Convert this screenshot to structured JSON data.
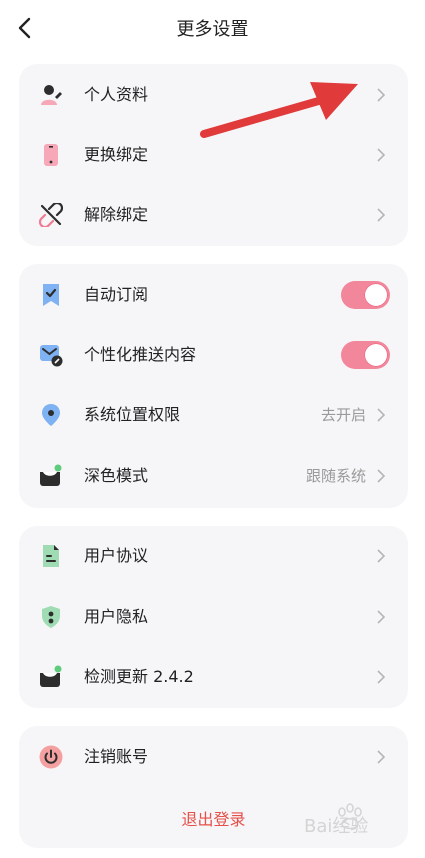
{
  "header": {
    "title": "更多设置"
  },
  "group1": [
    {
      "label": "个人资料",
      "icon": "profile-icon"
    },
    {
      "label": "更换绑定",
      "icon": "phone-icon"
    },
    {
      "label": "解除绑定",
      "icon": "unlink-icon"
    }
  ],
  "group2": [
    {
      "label": "自动订阅",
      "icon": "bookmark-icon",
      "toggle": true
    },
    {
      "label": "个性化推送内容",
      "icon": "push-mail-icon",
      "toggle": true
    },
    {
      "label": "系统位置权限",
      "icon": "location-icon",
      "value": "去开启"
    },
    {
      "label": "深色模式",
      "icon": "dark-mode-icon",
      "value": "跟随系统"
    }
  ],
  "group3": [
    {
      "label": "用户协议",
      "icon": "agreement-icon"
    },
    {
      "label": "用户隐私",
      "icon": "privacy-icon"
    },
    {
      "label": "检测更新 2.4.2",
      "icon": "update-icon"
    }
  ],
  "group4": [
    {
      "label": "注销账号",
      "icon": "power-icon"
    }
  ],
  "logout_label": "退出登录",
  "watermark_text": "Bai经验",
  "colors": {
    "accent": "#f2869b",
    "danger": "#e5504a",
    "annotation_arrow": "#e03a3a"
  }
}
